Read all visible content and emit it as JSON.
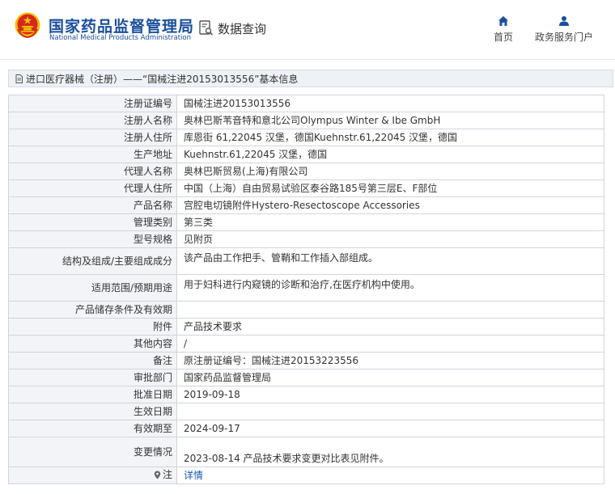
{
  "header": {
    "title_cn": "国家药品监督管理局",
    "title_en": "National Medical Products Administration",
    "search_label": "数据查询",
    "nav_home": "首页",
    "nav_service": "政务服务门户"
  },
  "breadcrumb": "进口医疗器械（注册）——“国械注进20153013556”基本信息",
  "rows": [
    {
      "label": "注册证编号",
      "value": "国械注进20153013556"
    },
    {
      "label": "注册人名称",
      "value": "奥林巴斯苇音特和意北公司Olympus Winter & Ibe GmbH"
    },
    {
      "label": "注册人住所",
      "value": "库恩街 61,22045 汉堡，德国Kuehnstr.61,22045 汉堡，德国"
    },
    {
      "label": "生产地址",
      "value": "Kuehnstr.61,22045 汉堡，德国"
    },
    {
      "label": "代理人名称",
      "value": "奥林巴斯贸易(上海)有限公司"
    },
    {
      "label": "代理人住所",
      "value": "中国（上海）自由贸易试验区泰谷路185号第三层E、F部位"
    },
    {
      "label": "产品名称",
      "value": "宫腔电切镜附件Hystero-Resectoscope Accessories"
    },
    {
      "label": "管理类别",
      "value": "第三类"
    },
    {
      "label": "型号规格",
      "value": "见附页"
    },
    {
      "label": "结构及组成/主要组成成分",
      "value": "该产品由工作把手、管鞘和工作插入部组成。"
    },
    {
      "label": "适用范围/预期用途",
      "value": "用于妇科进行内窥镜的诊断和治疗,在医疗机构中使用。"
    },
    {
      "label": "产品储存条件及有效期",
      "value": ""
    },
    {
      "label": "附件",
      "value": "产品技术要求"
    },
    {
      "label": "其他内容",
      "value": "/"
    },
    {
      "label": "备注",
      "value": "原注册证编号：国械注进20153223556"
    },
    {
      "label": "审批部门",
      "value": "国家药品监督管理局"
    },
    {
      "label": "批准日期",
      "value": "2019-09-18"
    },
    {
      "label": "生效日期",
      "value": ""
    },
    {
      "label": "有效期至",
      "value": "2024-09-17"
    },
    {
      "label": "变更情况",
      "value": "2023-08-14 产品技术要求变更对比表见附件。"
    },
    {
      "label": "注",
      "value": "详情"
    }
  ],
  "colors": {
    "brand_blue": "#1a4f9c",
    "emblem_red": "#d7261c",
    "emblem_gold": "#f2c200",
    "link": "#1a56b8"
  }
}
